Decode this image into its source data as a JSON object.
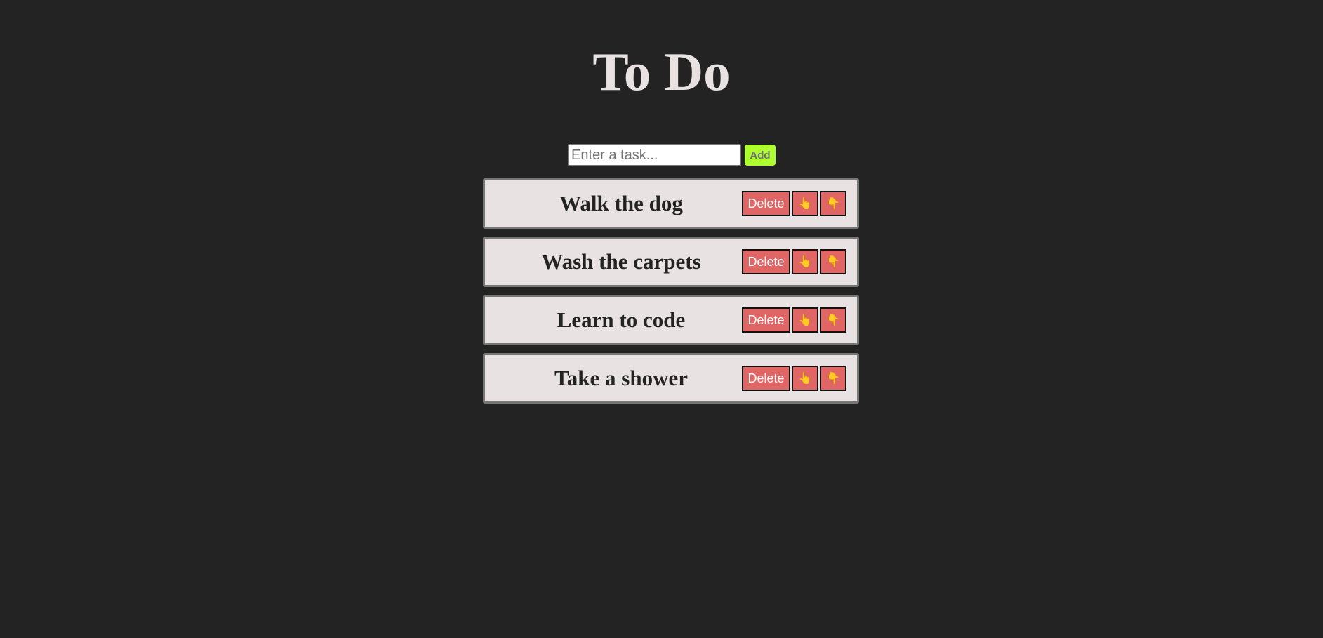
{
  "header": {
    "title": "To Do"
  },
  "new_task": {
    "placeholder": "Enter a task...",
    "value": "",
    "add_label": "Add"
  },
  "tasks": [
    {
      "text": "Walk the dog",
      "delete_label": "Delete",
      "up_icon": "👆",
      "down_icon": "👇"
    },
    {
      "text": "Wash the carpets",
      "delete_label": "Delete",
      "up_icon": "👆",
      "down_icon": "👇"
    },
    {
      "text": "Learn to code",
      "delete_label": "Delete",
      "up_icon": "👆",
      "down_icon": "👇"
    },
    {
      "text": "Take a shower",
      "delete_label": "Delete",
      "up_icon": "👆",
      "down_icon": "👇"
    }
  ],
  "colors": {
    "background": "#232323",
    "title": "#e8e2e2",
    "add_button": "#adff2f",
    "task_background": "#e8e2e2",
    "task_button": "#e06666"
  }
}
